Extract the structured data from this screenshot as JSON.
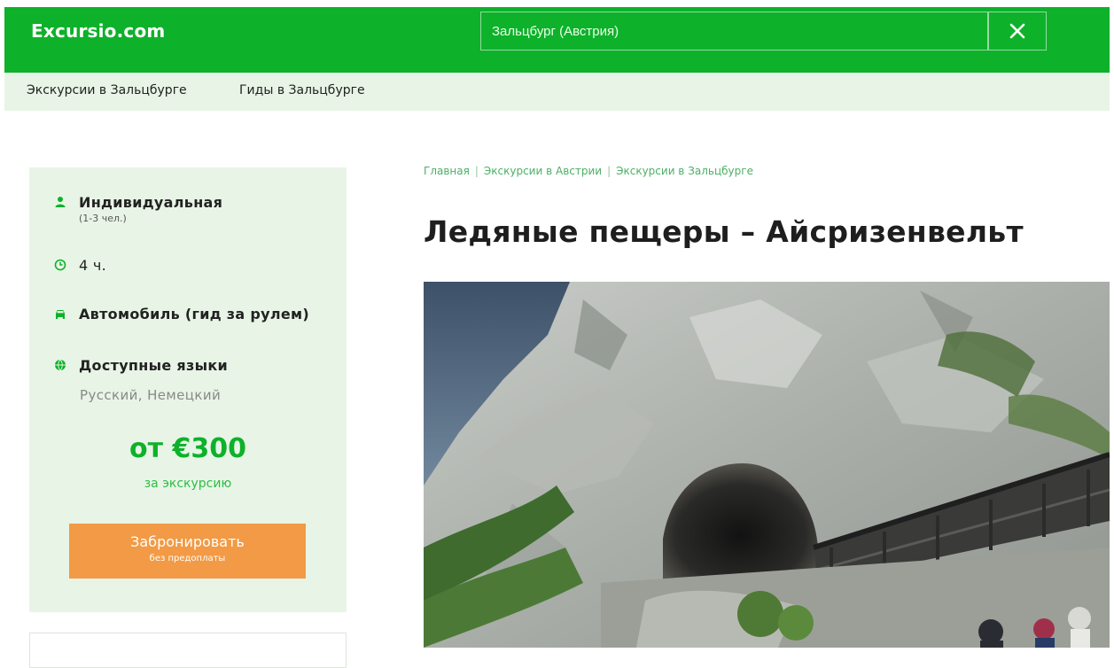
{
  "header": {
    "logo": "Excursio.com",
    "search_value": "Зальцбург (Австрия)"
  },
  "subnav": {
    "items": [
      "Экскурсии в Зальцбурге",
      "Гиды в Зальцбурге"
    ]
  },
  "sidebar": {
    "type_title": "Индивидуальная",
    "type_sub": "(1-3 чел.)",
    "duration": "4 ч.",
    "transport": "Автомобиль (гид за рулем)",
    "languages_title": "Доступные языки",
    "languages": "Русский,  Немецкий",
    "price": "от €300",
    "price_note": "за экскурсию",
    "book_label": "Забронировать",
    "book_sub": "без предоплаты"
  },
  "breadcrumb": [
    "Главная",
    "Экскурсии в Австрии",
    "Экскурсии в Зальцбурге"
  ],
  "page_title": "Ледяные пещеры – Айсризенвельт",
  "colors": {
    "brand_green": "#0eb12a",
    "light_green_bg": "#e8f5e6",
    "cta_orange": "#f29a45"
  },
  "icons": [
    "user-icon",
    "clock-icon",
    "car-icon",
    "globe-icon",
    "close-icon"
  ]
}
